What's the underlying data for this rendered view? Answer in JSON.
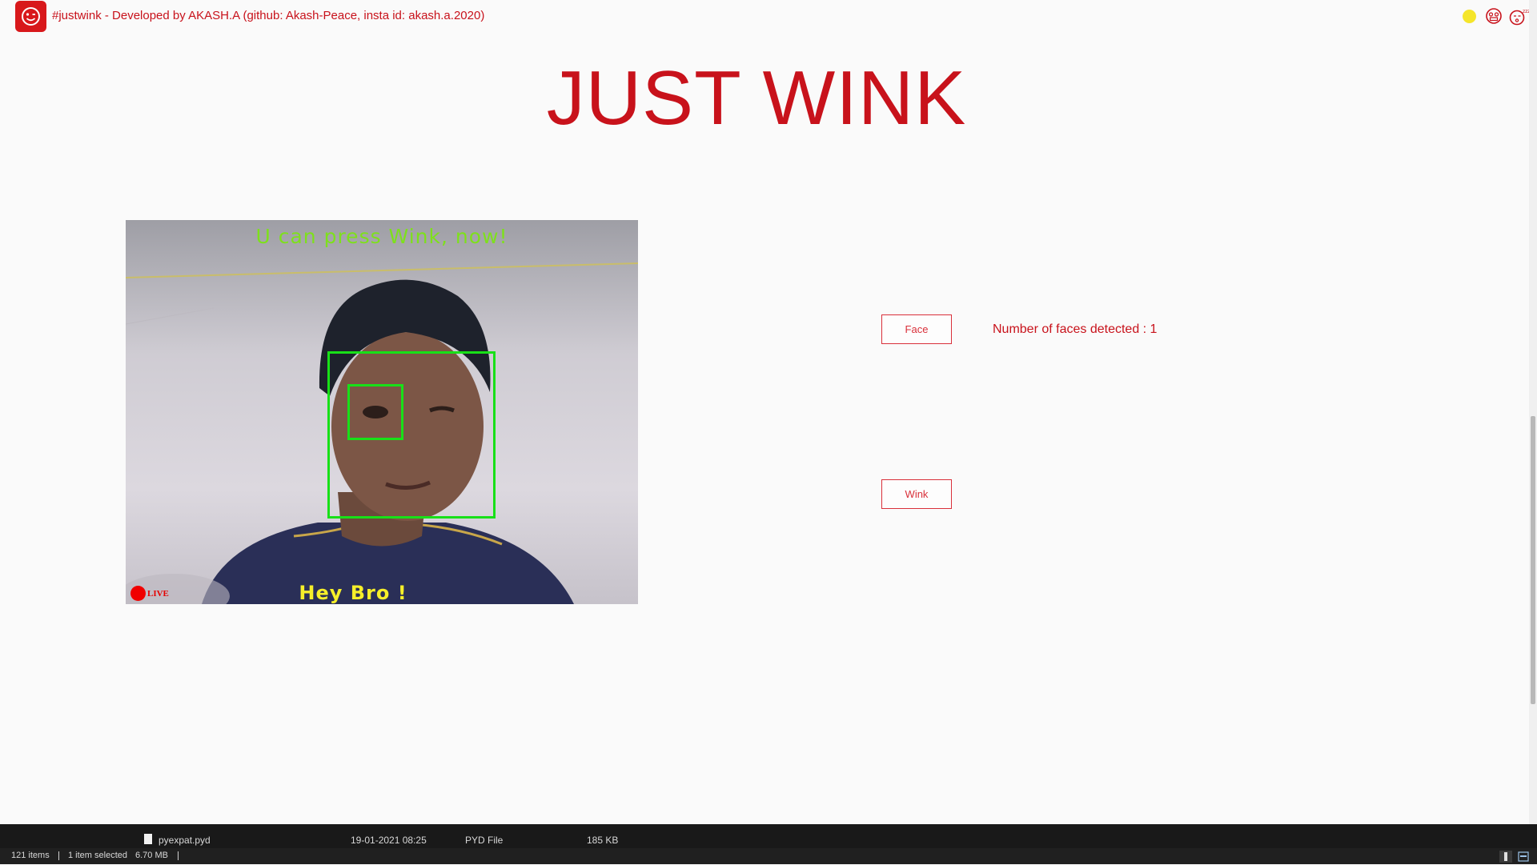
{
  "window": {
    "title": "#justwink - Developed by AKASH.A (github: Akash-Peace, insta id: akash.a.2020)",
    "app_icon": "winking-smiley-icon",
    "controls": [
      "minimize-dot-icon",
      "maximize-face-icon",
      "close-sleepy-face-icon"
    ]
  },
  "heading": "JUST WINK",
  "camera": {
    "overlay_top": "U can press Wink, now!",
    "overlay_bottom": "Hey Bro !",
    "live_label": "LIVE",
    "box_color": "#18e018"
  },
  "controls": {
    "face_button": "Face",
    "wink_button": "Wink",
    "faces_detected": "Number of faces detected : 1"
  },
  "explorer": {
    "file": {
      "name": "pyexpat.pyd",
      "date": "19-01-2021 08:25",
      "type": "PYD File",
      "size": "185 KB"
    },
    "status": {
      "items": "121 items",
      "selected": "1 item selected",
      "selected_size": "6.70 MB"
    }
  },
  "colors": {
    "accent": "#c8121b",
    "background": "#fafafa",
    "overlay_green": "#7ee01c",
    "overlay_yellow": "#f6ef2a"
  }
}
